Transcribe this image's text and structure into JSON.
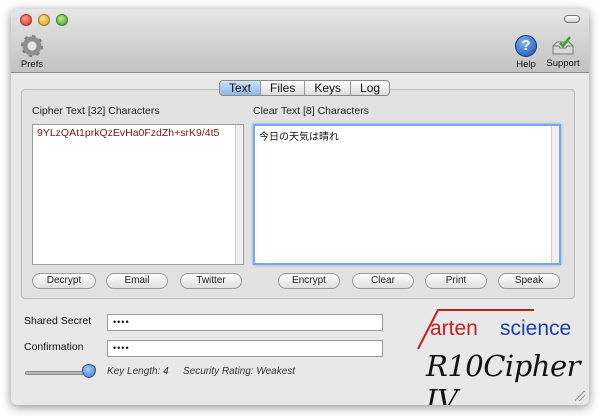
{
  "toolbar": {
    "prefs_label": "Prefs",
    "help_label": "Help",
    "support_label": "Support"
  },
  "tabs": [
    {
      "label": "Text",
      "active": true
    },
    {
      "label": "Files",
      "active": false
    },
    {
      "label": "Keys",
      "active": false
    },
    {
      "label": "Log",
      "active": false
    }
  ],
  "cipher": {
    "label": "Cipher Text [32] Characters",
    "value": "9YLzQAt1prkQzEvHa0FzdZh+srK9/4t5",
    "buttons": [
      "Decrypt",
      "Email",
      "Twitter"
    ]
  },
  "clear": {
    "label": "Clear Text [8] Characters",
    "value": "今日の天気は晴れ",
    "buttons": [
      "Encrypt",
      "Clear",
      "Print",
      "Speak"
    ]
  },
  "fields": {
    "shared_secret_label": "Shared Secret",
    "shared_secret_value": "••••",
    "confirmation_label": "Confirmation",
    "confirmation_value": "••••"
  },
  "key_info": {
    "key_length": "Key Length:  4",
    "security_rating": "Security Rating:  Weakest",
    "slider_level": 1.0
  },
  "logo": {
    "company_arten": "arten",
    "company_science": "science",
    "product": "R10Cipher IV"
  },
  "colors": {
    "cipher_text": "#7a1414",
    "focus_ring": "#7aa7e6",
    "tab_active": "#8fb6e6",
    "logo_red": "#c21f1f",
    "logo_blue": "#1f3fa8"
  }
}
